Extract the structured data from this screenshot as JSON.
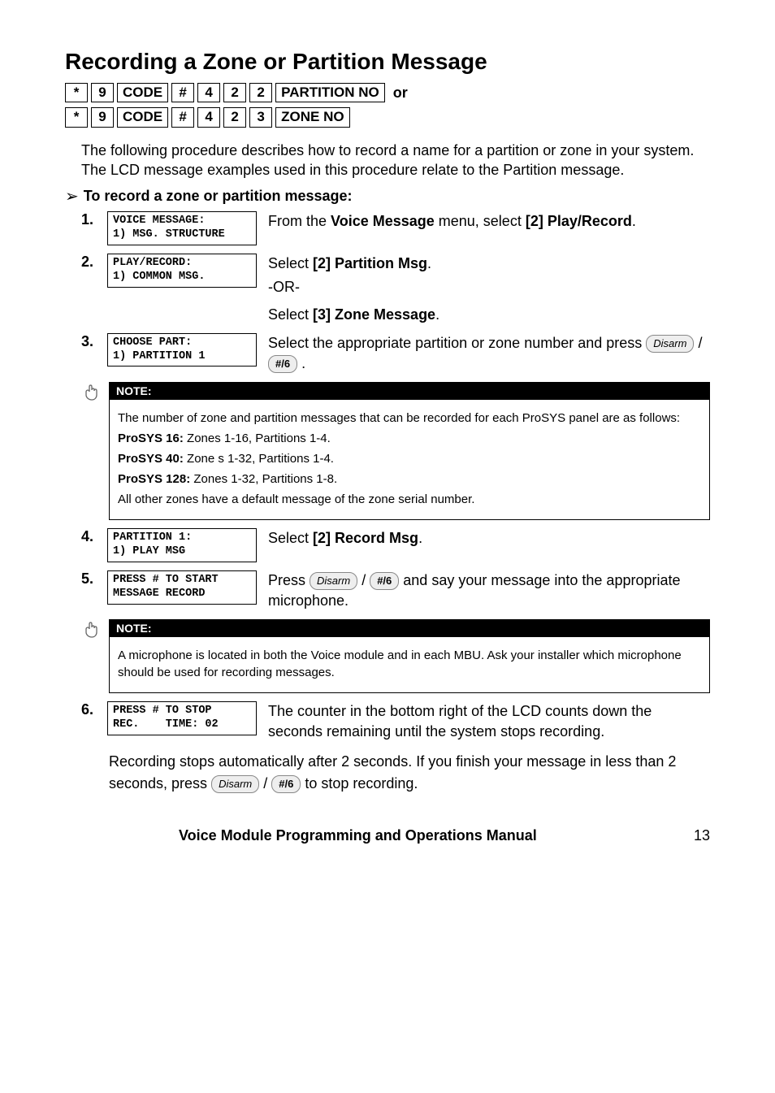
{
  "title": "Recording a Zone or Partition Message",
  "keyrow1": [
    "*",
    "9",
    "CODE",
    "#",
    "4",
    "2",
    "2",
    "PARTITION NO"
  ],
  "keyrow1_or": "or",
  "keyrow2": [
    "*",
    "9",
    "CODE",
    "#",
    "4",
    "2",
    "3",
    "ZONE NO"
  ],
  "intro": "The following procedure describes how to record a name for a partition or zone in your system. The LCD message examples used in this procedure relate to the Partition message.",
  "subhead": "To record a zone or partition message:",
  "steps": {
    "s1": {
      "num": "1.",
      "lcd": "VOICE MESSAGE:\n1) MSG. STRUCTURE",
      "body_pre": "From the ",
      "body_bold1": "Voice Message",
      "body_mid": " menu, select ",
      "body_bold2": "[2] Play/Record",
      "body_post": "."
    },
    "s2": {
      "num": "2.",
      "lcd": "PLAY/RECORD:\n1) COMMON MSG.",
      "line1_pre": "Select ",
      "line1_bold": "[2] Partition Msg",
      "line1_post": ".",
      "or": "-OR-",
      "line2_pre": "Select ",
      "line2_bold": "[3] Zone Message",
      "line2_post": "."
    },
    "s3": {
      "num": "3.",
      "lcd": "CHOOSE PART:\n1) PARTITION 1",
      "body_pre": "Select the appropriate partition or zone number and press ",
      "btn1": "Disarm",
      "slash": " / ",
      "btn2": "#/6",
      "body_post": " ."
    },
    "s4": {
      "num": "4.",
      "lcd": "PARTITION 1:\n1) PLAY MSG",
      "body_pre": "Select ",
      "body_bold": "[2] Record Msg",
      "body_post": "."
    },
    "s5": {
      "num": "5.",
      "lcd": "PRESS # TO START\nMESSAGE RECORD",
      "body_pre": "Press ",
      "btn1": "Disarm",
      "slash": " / ",
      "btn2": "#/6",
      "body_post": " and say your message into the appropriate microphone."
    },
    "s6": {
      "num": "6.",
      "lcd": "PRESS # TO STOP\nREC.    TIME: 02",
      "body": "The counter in the bottom right of the LCD counts down the seconds remaining until the system stops recording."
    }
  },
  "note1": {
    "label": "NOTE:",
    "p1": "The number of zone and partition messages that can be recorded for each ProSYS panel are as follows:",
    "l1b": "ProSYS 16:",
    "l1": " Zones 1-16, Partitions 1-4.",
    "l2b": "ProSYS 40:",
    "l2": " Zone s 1-32, Partitions 1-4.",
    "l3b": "ProSYS 128:",
    "l3": " Zones 1-32, Partitions 1-8.",
    "p2": "All other zones have a default message of the zone serial number."
  },
  "note2": {
    "label": "NOTE:",
    "p1": "A microphone is located in both the Voice module and in each MBU. Ask your installer which microphone should be used for recording messages."
  },
  "tail": {
    "p1": "Recording stops automatically after 2 seconds. If you finish your message in less than 2 seconds, press ",
    "btn1": "Disarm",
    "slash": " / ",
    "btn2": "#/6",
    "p2": " to stop recording."
  },
  "footer_title": "Voice Module Programming and Operations Manual",
  "footer_page": "13"
}
